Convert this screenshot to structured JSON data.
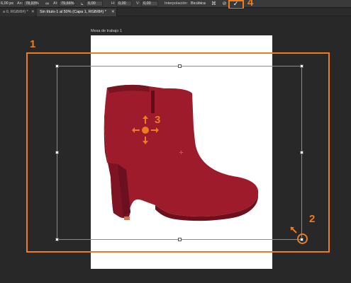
{
  "options_bar": {
    "x_value": "6,00 px",
    "an_label": "An:",
    "an_value": "78,93%",
    "link_icon": "link-icon",
    "al_label": "Al:",
    "al_value": "79,66%",
    "angle_value": "0,00",
    "h_label": "H:",
    "h_value": "0,00",
    "v_label": "V:",
    "v_value": "0,00",
    "interpolation_label": "Interpolación:",
    "interpolation_value": "Bicúbica",
    "warp_icon": "warp-icon",
    "cancel_icon": "cancel-icon",
    "confirm_icon": "checkmark-icon"
  },
  "tabs": {
    "inactive_label": "a 0, RGB/8#) *",
    "active_label": "Sin título-1 al 50% (Capa 1, RGB/8#) *"
  },
  "canvas": {
    "artboard_label": "Mesa de trabajo 1",
    "image_subject": "red suede ankle boot with snakeskin heel"
  },
  "callouts": [
    "1",
    "2",
    "3",
    "4"
  ],
  "colors": {
    "accent": "#ee7b1e",
    "ui_bg": "#282828",
    "boot_red": "#9e1b2c"
  }
}
